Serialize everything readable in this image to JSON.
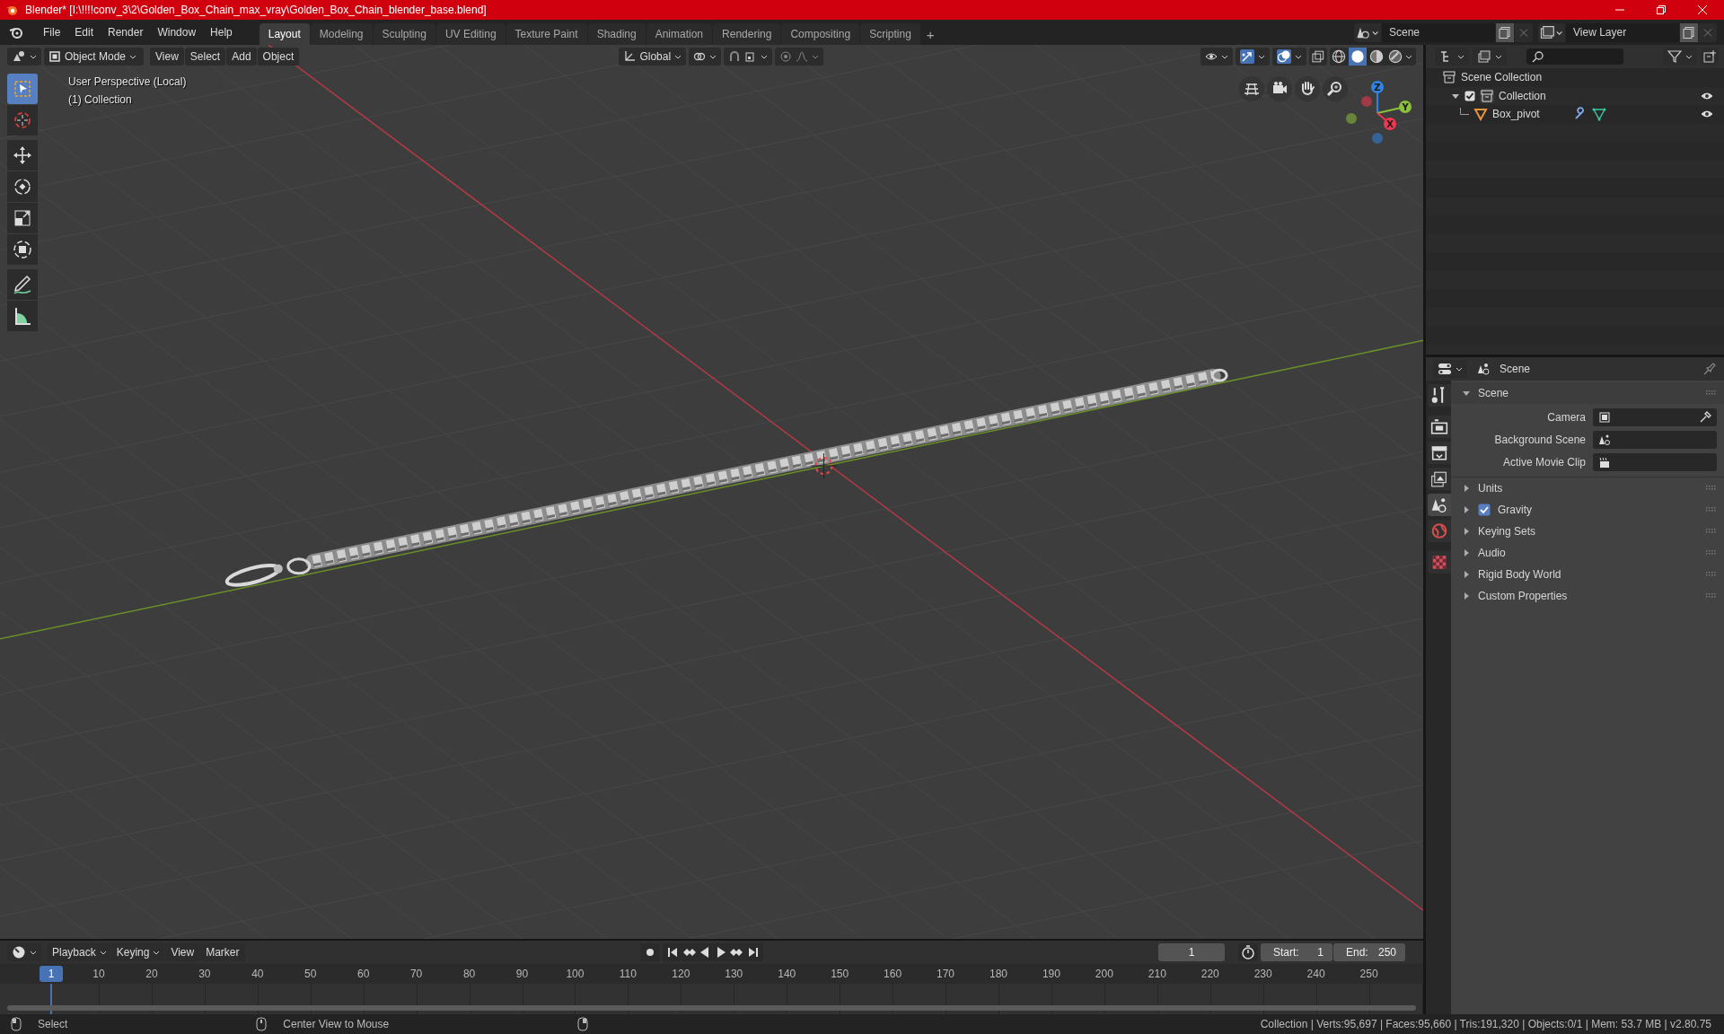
{
  "window": {
    "title": "Blender* [I:\\!!!!conv_3\\2\\Golden_Box_Chain_max_vray\\Golden_Box_Chain_blender_base.blend]"
  },
  "menu": [
    "File",
    "Edit",
    "Render",
    "Window",
    "Help"
  ],
  "workspaces": [
    {
      "label": "Layout",
      "selected": true
    },
    {
      "label": "Modeling",
      "selected": false
    },
    {
      "label": "Sculpting",
      "selected": false
    },
    {
      "label": "UV Editing",
      "selected": false
    },
    {
      "label": "Texture Paint",
      "selected": false
    },
    {
      "label": "Shading",
      "selected": false
    },
    {
      "label": "Animation",
      "selected": false
    },
    {
      "label": "Rendering",
      "selected": false
    },
    {
      "label": "Compositing",
      "selected": false
    },
    {
      "label": "Scripting",
      "selected": false
    }
  ],
  "add_workspace": "+",
  "scene": {
    "value": "Scene"
  },
  "view_layer": {
    "value": "View Layer"
  },
  "viewport": {
    "mode": "Object Mode",
    "menus": [
      "View",
      "Select",
      "Add",
      "Object"
    ],
    "orientation": "Global",
    "gizmos": {
      "on": true
    },
    "overlays": {
      "on": true
    },
    "info": [
      "User Perspective (Local)",
      "(1) Collection"
    ],
    "tools": [
      {
        "kind": "select",
        "selected": true
      },
      {
        "kind": "cursor",
        "selected": false
      },
      {
        "kind": "move",
        "selected": false
      },
      {
        "kind": "rotate",
        "selected": false
      },
      {
        "kind": "scale",
        "selected": false
      },
      {
        "kind": "transform",
        "selected": false
      },
      {
        "kind": "annotate",
        "selected": false
      },
      {
        "kind": "measure",
        "selected": false
      }
    ],
    "shading": [
      {
        "kind": "wireframe",
        "selected": false
      },
      {
        "kind": "solid",
        "selected": true
      },
      {
        "kind": "material",
        "selected": false
      },
      {
        "kind": "rendered",
        "selected": false
      }
    ],
    "gizmo": [
      {
        "label": "Z",
        "color": "#2f84e3"
      },
      {
        "label": "Y",
        "color": "#8ac03a"
      },
      {
        "label": "X",
        "color": "#f0374f"
      }
    ]
  },
  "outliner": {
    "items": [
      {
        "label": "Scene Collection",
        "kind": "collection",
        "children": [
          {
            "label": "Collection",
            "kind": "collection",
            "checked": true,
            "expanded": true,
            "visible": true,
            "children": [
              {
                "label": "Box_pivot",
                "kind": "mesh",
                "visible": true
              }
            ]
          }
        ]
      }
    ]
  },
  "properties": {
    "context": "Scene",
    "tabs": [
      {
        "kind": "tool",
        "selected": false
      },
      {
        "kind": "render",
        "selected": false
      },
      {
        "kind": "output",
        "selected": false
      },
      {
        "kind": "view_layer",
        "selected": false
      },
      {
        "kind": "scene",
        "selected": true
      },
      {
        "kind": "world",
        "selected": false
      },
      {
        "kind": "texture",
        "selected": false
      }
    ],
    "panels": [
      {
        "title": "Scene",
        "expanded": true,
        "fields": [
          {
            "label": "Camera",
            "kind": "camera"
          },
          {
            "label": "Background Scene",
            "kind": "scene"
          },
          {
            "label": "Active Movie Clip",
            "kind": "clip"
          }
        ]
      },
      {
        "title": "Units",
        "expanded": false
      },
      {
        "title": "Gravity",
        "expanded": false,
        "kind": "checkbox",
        "checked": true
      },
      {
        "title": "Keying Sets",
        "expanded": false
      },
      {
        "title": "Audio",
        "expanded": false
      },
      {
        "title": "Rigid Body World",
        "expanded": false
      },
      {
        "title": "Custom Properties",
        "expanded": false
      }
    ]
  },
  "timeline": {
    "menus": [
      {
        "label": "Playback",
        "kind": "dropdown"
      },
      {
        "label": "Keying",
        "kind": "dropdown"
      },
      {
        "label": "View",
        "kind": "menu"
      },
      {
        "label": "Marker",
        "kind": "menu"
      }
    ],
    "current_frame": "1",
    "start": {
      "label": "Start:",
      "value": "1"
    },
    "end": {
      "label": "End:",
      "value": "250"
    },
    "playhead_frame": "1",
    "ruler": [
      "10",
      "20",
      "30",
      "40",
      "50",
      "60",
      "70",
      "80",
      "90",
      "100",
      "110",
      "120",
      "130",
      "140",
      "150",
      "160",
      "170",
      "180",
      "190",
      "200",
      "210",
      "220",
      "230",
      "240",
      "250"
    ]
  },
  "status_bar": {
    "hints": [
      {
        "kind": "left_mouse",
        "label": "Select"
      },
      {
        "kind": "middle_mouse",
        "label": "Center View to Mouse"
      },
      {
        "kind": "right_mouse"
      }
    ],
    "stats": "Collection | Verts:95,697 | Faces:95,660 | Tris:191,320 | Objects:0/1 | Mem: 53.7 MB | v2.80.75"
  }
}
